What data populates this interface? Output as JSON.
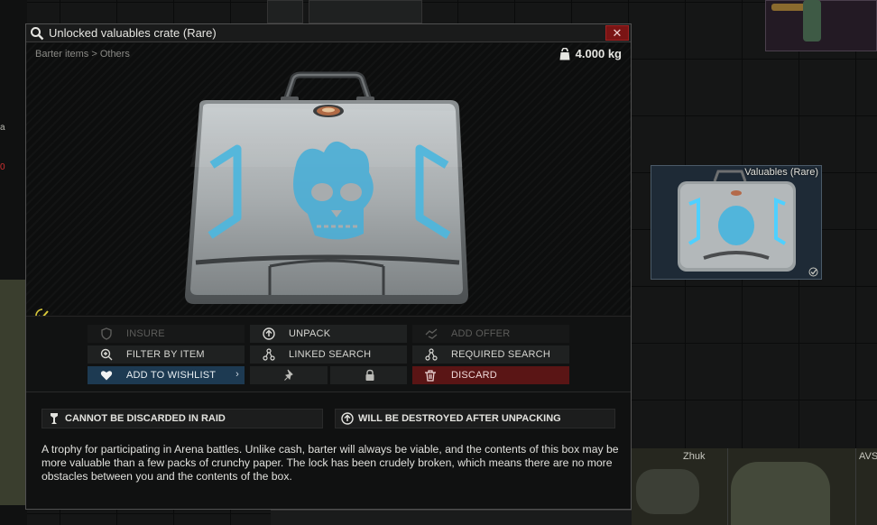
{
  "window": {
    "title": "Unlocked valuables crate (Rare)",
    "close_glyph": "✕",
    "breadcrumb": "Barter items > Others",
    "weight": "4.000 kg",
    "icons": {
      "title": "magnifier-icon",
      "weight": "kettlebell-icon",
      "found_in_raid": "checkmark-icon"
    }
  },
  "actions": {
    "insure": "INSURE",
    "unpack": "UNPACK",
    "add_offer": "ADD OFFER",
    "filter_by_item": "FILTER BY ITEM",
    "linked_search": "LINKED SEARCH",
    "required_search": "REQUIRED SEARCH",
    "add_to_wishlist": "ADD TO WISHLIST",
    "wishlist_chevron": "›",
    "pin_icon": "pin-icon",
    "lock_icon": "lock-icon",
    "discard": "DISCARD",
    "disabled": [
      "insure",
      "add_offer"
    ]
  },
  "properties": {
    "no_discard": "CANNOT BE DISCARDED IN RAID",
    "destroyed": "WILL BE DESTROYED AFTER UNPACKING"
  },
  "description": "A trophy for participating in Arena battles. Unlike cash, barter will always be viable, and the contents of this box may be more valuable than a few packs of crunchy paper. The lock has been crudely broken, which means there are no more obstacles between you and the contents of the box.",
  "background": {
    "card_label": "Valuables (Rare)",
    "slot_label_1": "Zhuk",
    "slot_label_2": "AVS",
    "edge_letter": "a"
  },
  "colors": {
    "wishlist": "#1d3a52",
    "discard": "#5a1515",
    "close": "#7a1414",
    "crate_accent": "#4fb6dc"
  }
}
